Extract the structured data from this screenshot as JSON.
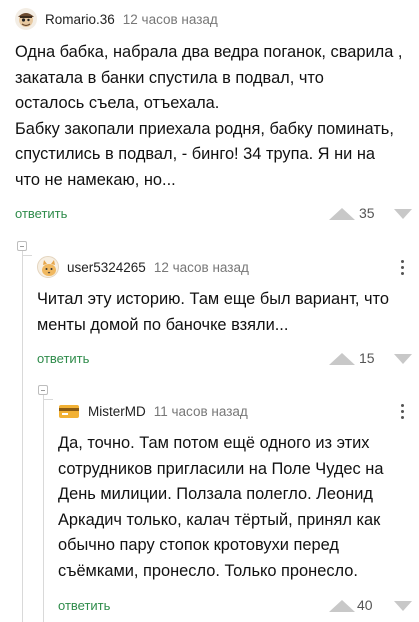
{
  "comments": [
    {
      "author": "Romario.36",
      "time": "12 часов назад",
      "lines": [
        "Одна бабка, набрала два ведра поганок, сварила ,",
        "закатала в банки спустила в подвал, что",
        "осталось съела, отъехала.",
        "Бабку закопали приехала родня, бабку поминать,",
        "спустились в подвал, - бинго! 34 трупа. Я ни на",
        "что не намекаю, но..."
      ],
      "reply_label": "ответить",
      "votes": "35",
      "avatar_icon": "pirate-avatar-icon"
    },
    {
      "author": "user5324265",
      "time": "12 часов назад",
      "lines": [
        "Читал эту историю. Там еще был вариант, что",
        "менты домой по баночке взяли..."
      ],
      "reply_label": "ответить",
      "votes": "15",
      "avatar_icon": "cat-avatar-icon"
    },
    {
      "author": "MisterMD",
      "time": "11 часов назад",
      "lines": [
        "Да, точно. Там потом ещё одного из этих",
        "сотрудников пригласили на Поле Чудес на",
        "День милиции. Ползала полегло. Леонид",
        "Аркадич только, калач тёртый, принял как",
        "обычно пару стопок кротовухи перед",
        "съёмками, пронесло. Только пронесло."
      ],
      "reply_label": "ответить",
      "votes": "40",
      "avatar_icon": "card-avatar-icon"
    }
  ],
  "colors": {
    "reply_link": "#2e8b4a",
    "vote_arrow": "#c8c8c8",
    "thread_line": "#d9d9d9"
  }
}
